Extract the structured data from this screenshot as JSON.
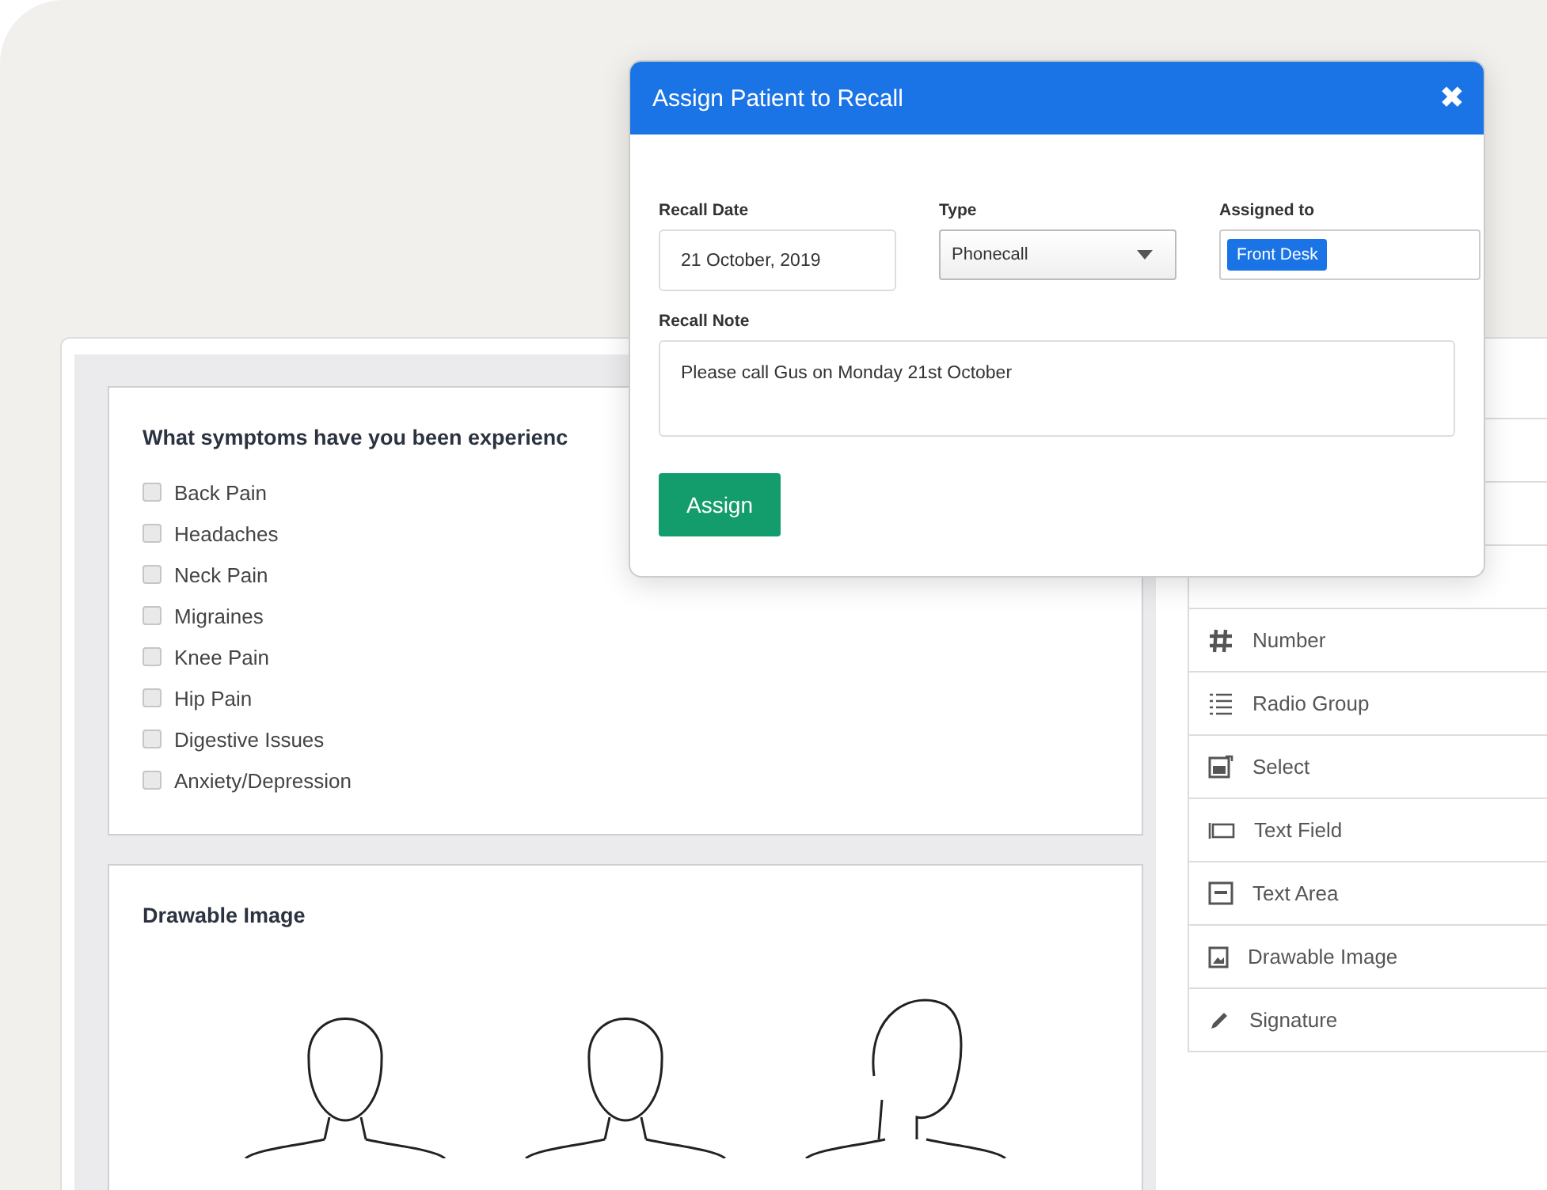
{
  "form": {
    "question": "What symptoms have you been experienc",
    "options": [
      {
        "label": "Back Pain",
        "checked": false
      },
      {
        "label": "Headaches",
        "checked": false
      },
      {
        "label": "Neck Pain",
        "checked": false
      },
      {
        "label": "Migraines",
        "checked": false
      },
      {
        "label": "Knee Pain",
        "checked": false
      },
      {
        "label": "Hip Pain",
        "checked": false
      },
      {
        "label": "Digestive Issues",
        "checked": false
      },
      {
        "label": "Anxiety/Depression",
        "checked": false
      }
    ],
    "drawable_title": "Drawable Image"
  },
  "sidebar": {
    "items": [
      {
        "label": "Number",
        "kind": "number"
      },
      {
        "label": "Radio Group",
        "kind": "radio"
      },
      {
        "label": "Select",
        "kind": "select"
      },
      {
        "label": "Text Field",
        "kind": "textfield"
      },
      {
        "label": "Text Area",
        "kind": "textarea"
      },
      {
        "label": "Drawable Image",
        "kind": "image"
      },
      {
        "label": "Signature",
        "kind": "signature"
      }
    ]
  },
  "modal": {
    "title": "Assign Patient to Recall",
    "close": "✖",
    "date_label": "Recall Date",
    "date_value": "21 October, 2019",
    "type_label": "Type",
    "type_value": "Phonecall",
    "assigned_label": "Assigned to",
    "assigned_tag": "Front Desk",
    "note_label": "Recall Note",
    "note_value": "Please call Gus on Monday 21st October",
    "button": "Assign"
  }
}
